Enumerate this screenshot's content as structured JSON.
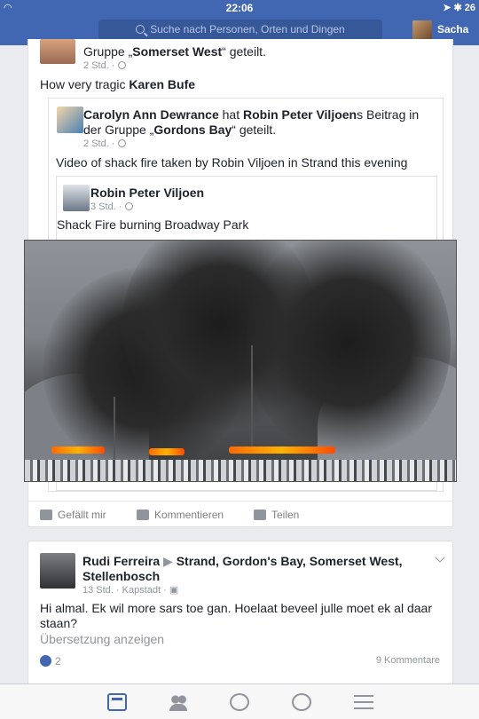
{
  "status_bar": {
    "time": "22:06",
    "battery": "26"
  },
  "nav": {
    "search_placeholder": "Suche nach Personen, Orten und Dingen",
    "profile_name": "Sacha"
  },
  "post1": {
    "header_prefix": "Gruppe „",
    "group": "Somerset West",
    "header_suffix": "“ geteilt.",
    "time": "2 Std.",
    "text_prefix": "How very tragic ",
    "text_bold": "Karen Bufe",
    "shared": {
      "author": "Carolyn Ann Dewrance",
      "verb": " hat ",
      "target": "Robin Peter Viljoen",
      "mid": "s Beitrag in der Gruppe „",
      "group": "Gordons Bay",
      "end": "“ geteilt.",
      "time": "2 Std.",
      "text": "Video of shack fire taken by Robin Viljoen in Strand this evening",
      "inner": {
        "author": "Robin Peter Viljoen",
        "time": "3 Std.",
        "text": "Shack Fire burning Broadway Park"
      }
    },
    "actions": {
      "like": "Gefällt mir",
      "comment": "Kommentieren",
      "share": "Teilen"
    }
  },
  "post2": {
    "author": "Rudi Ferreira",
    "arrow": " ▶ ",
    "target": "Strand, Gordon's Bay, Somerset West, Stellenbosch",
    "time": "13 Std.",
    "location": "Kapstadt",
    "text": "Hi almal. Ek wil more sars toe gan. Hoelaat beveel julle moet ek al daar staan?",
    "translate": "Übersetzung anzeigen",
    "likes": "2",
    "comments": "9 Kommentare"
  }
}
